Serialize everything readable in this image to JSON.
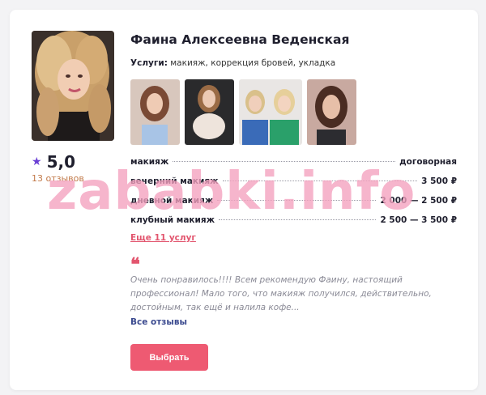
{
  "master": {
    "name": "Фаина Алексеевна Веденская",
    "services_label": "Услуги:",
    "services_value": "макияж, коррекция бровей, укладка",
    "rating": "5,0",
    "reviews_count": "13 отзывов"
  },
  "prices": [
    {
      "service": "макияж",
      "price": "договорная"
    },
    {
      "service": "вечерний макияж",
      "price": "3 500 ₽"
    },
    {
      "service": "дневной макияж",
      "price": "2 000 — 2 500 ₽"
    },
    {
      "service": "клубный макияж",
      "price": "2 500 — 3 500 ₽"
    }
  ],
  "more_services_link": "Еще 11 услуг",
  "review": {
    "quote_mark": "❝",
    "text": "Очень понравилось!!!! Всем рекомендую Фаину, настоящий профессионал! Мало того, что макияж получился, действительно, достойным, так ещё и налила кофе..."
  },
  "all_reviews_link": "Все отзывы",
  "choose_button": "Выбрать",
  "watermark": "zababki.info",
  "icons": {
    "star": "star-icon",
    "quote": "quote-icon"
  },
  "colors": {
    "accent": "#ee5a72",
    "link": "#3b4a8f",
    "star": "#6a3fd4",
    "reviews_count": "#c27a4a"
  }
}
